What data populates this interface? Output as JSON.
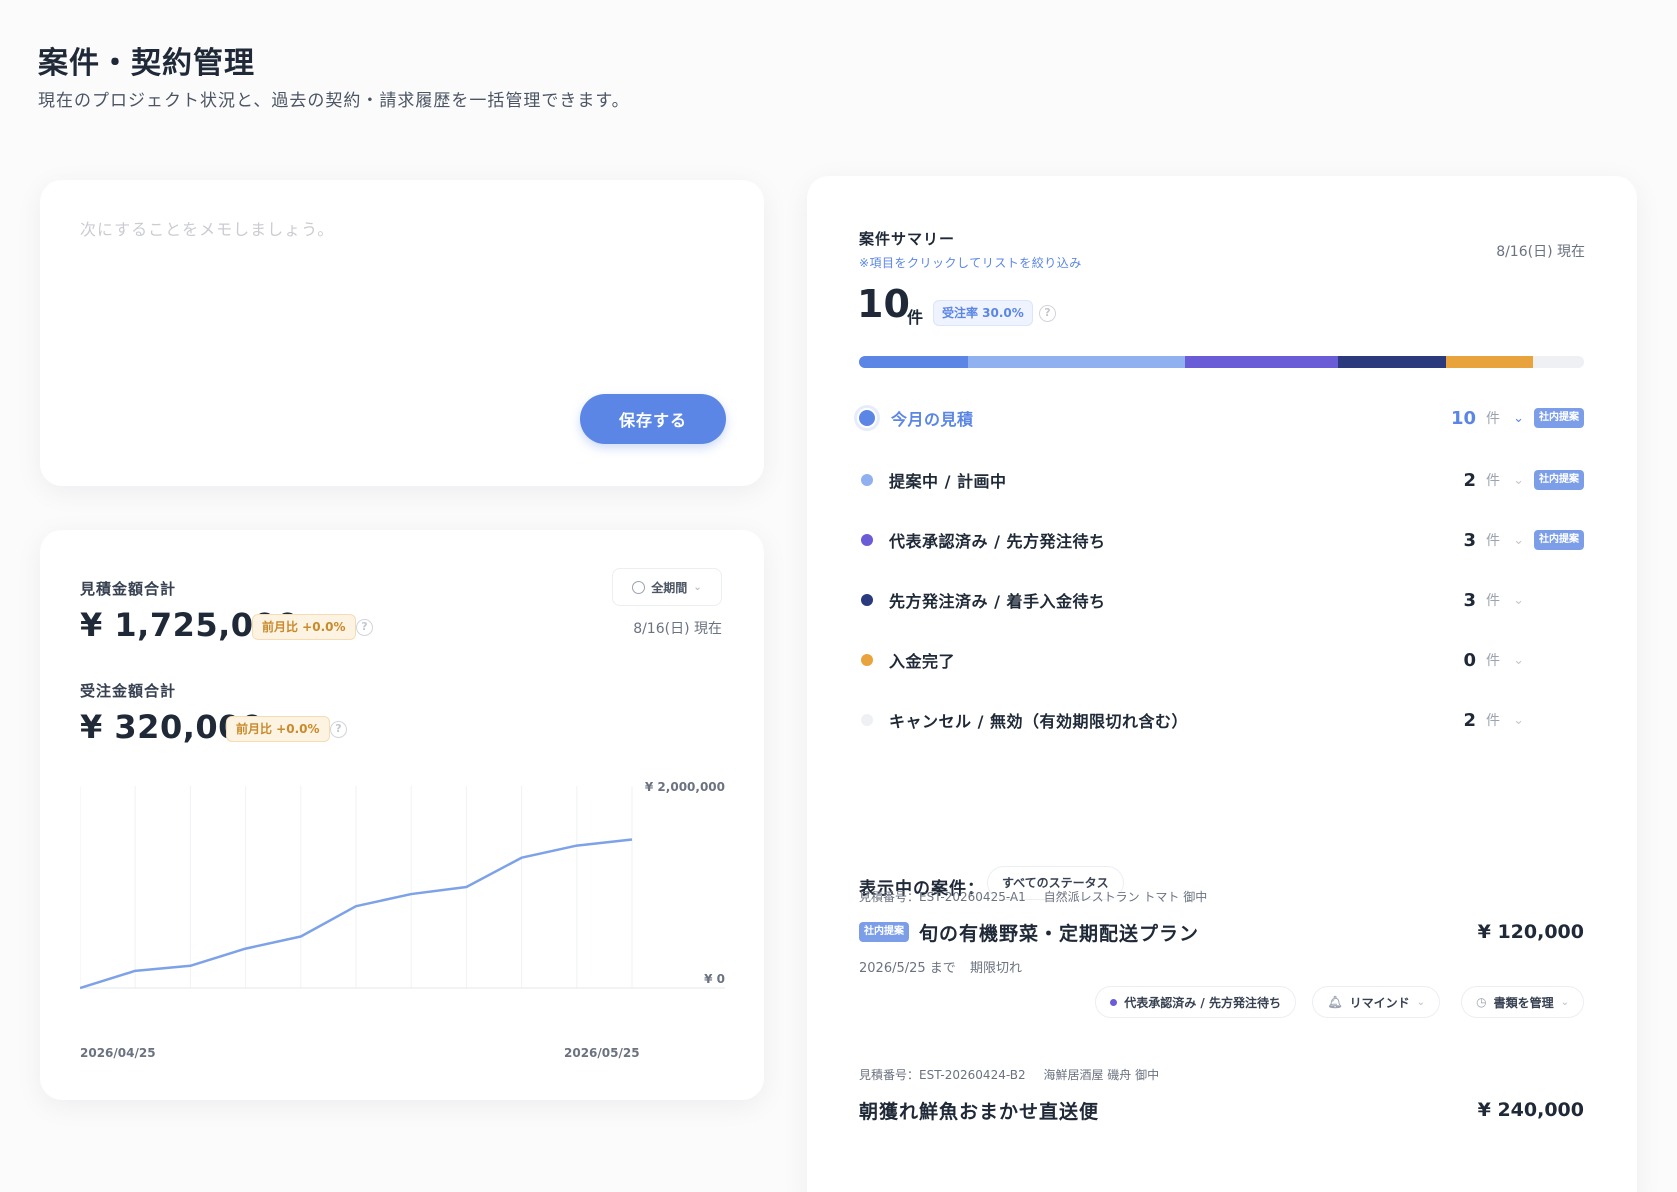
{
  "header": {
    "title": "案件・契約管理",
    "subtitle": "現在のプロジェクト状況と、過去の契約・請求履歴を一括管理できます。"
  },
  "memo": {
    "placeholder": "次にすることをメモしましょう。",
    "save_label": "保存する"
  },
  "stats": {
    "estimate": {
      "label": "見積金額合計",
      "value": "¥ 1,725,000",
      "mom": "前月比 +0.0%"
    },
    "order": {
      "label": "受注金額合計",
      "value": "¥ 320,000",
      "mom": "前月比 +0.0%"
    },
    "period_label": "全期間",
    "as_of": "8/16(日) 現在"
  },
  "chart_data": {
    "type": "line",
    "x": [
      "2026/04/25",
      "2026/04/28",
      "2026/05/01",
      "2026/05/04",
      "2026/05/07",
      "2026/05/10",
      "2026/05/13",
      "2026/05/16",
      "2026/05/19",
      "2026/05/22",
      "2026/05/25"
    ],
    "series": [
      {
        "values": [
          0,
          170000,
          220000,
          390000,
          510000,
          810000,
          930000,
          1000000,
          1290000,
          1410000,
          1470000
        ]
      }
    ],
    "ylim": [
      0,
      2000000
    ],
    "ytick_labels": [
      "¥ 2,000,000",
      "¥ 0"
    ],
    "xtick_labels": [
      "2026/04/25",
      "2026/05/25"
    ],
    "grid": true,
    "color": "#7da2e8"
  },
  "summary": {
    "title": "案件サマリー",
    "hint": "※項目をクリックしてリストを絞り込み",
    "as_of": "8/16(日) 現在",
    "total": "10",
    "total_unit": "件",
    "rate": "受注率 30.0%",
    "unit": "件",
    "internal_tag": "社内提案",
    "stack": [
      {
        "share": 15,
        "color": "#5b86e5"
      },
      {
        "share": 30,
        "color": "#8fb1ef"
      },
      {
        "share": 21,
        "color": "#6a5bd6"
      },
      {
        "share": 15,
        "color": "#2a3a7c"
      },
      {
        "share": 12,
        "color": "#e8a33d"
      },
      {
        "share": 7,
        "color": "#eef0f3"
      }
    ],
    "statuses": [
      {
        "label": "今月の見積",
        "count": "10",
        "color": "#5b86e5",
        "internal": true,
        "active": true
      },
      {
        "label": "提案中 / 計画中",
        "count": "2",
        "color": "#8fb1ef",
        "internal": true,
        "active": false
      },
      {
        "label": "代表承認済み / 先方発注待ち",
        "count": "3",
        "color": "#6a5bd6",
        "internal": true,
        "active": false
      },
      {
        "label": "先方発注済み / 着手入金待ち",
        "count": "3",
        "color": "#2a3a7c",
        "internal": false,
        "active": false
      },
      {
        "label": "入金完了",
        "count": "0",
        "color": "#e8a33d",
        "internal": false,
        "active": false
      },
      {
        "label": "キャンセル / 無効（有効期限切れ含む）",
        "count": "2",
        "color": "#eef0f3",
        "internal": false,
        "active": false
      }
    ]
  },
  "list": {
    "showing_label": "表示中の案件：",
    "filter": "すべてのステータス",
    "deals": [
      {
        "estimate_no": "見積番号：EST-20260425-A1",
        "client": "自然派レストラン トマト 御中",
        "tag": "社内提案",
        "title": "旬の有機野菜・定期配送プラン",
        "amount": "¥ 120,000",
        "due": "2026/5/25 まで",
        "due_status": "期限切れ",
        "status_pill": "代表承認済み / 先方発注待ち",
        "remind": "リマインド",
        "docs": "書類を管理"
      },
      {
        "estimate_no": "見積番号：EST-20260424-B2",
        "client": "海鮮居酒屋 磯舟 御中",
        "title": "朝獲れ鮮魚おまかせ直送便",
        "amount": "¥ 240,000"
      }
    ]
  }
}
